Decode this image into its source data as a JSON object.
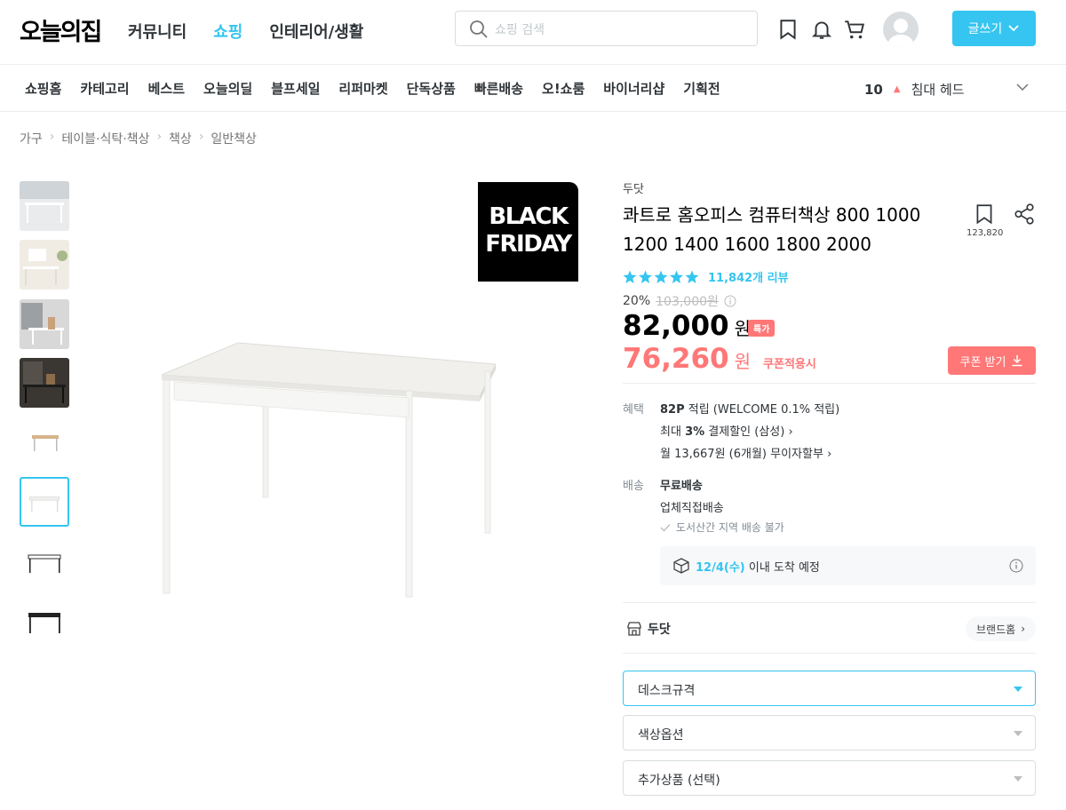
{
  "header": {
    "logo": "오늘의집",
    "nav": [
      "커뮤니티",
      "쇼핑",
      "인테리어/생활"
    ],
    "search_placeholder": "쇼핑 검색",
    "write_label": "글쓰기"
  },
  "subnav": {
    "items": [
      "쇼핑홈",
      "카테고리",
      "베스트",
      "오늘의딜",
      "블프세일",
      "리퍼마켓",
      "단독상품",
      "빠른배송",
      "오!쇼룸",
      "바이너리샵",
      "기획전"
    ],
    "rank_num": "10",
    "rank_term": "침대 헤드"
  },
  "breadcrumb": [
    "가구",
    "테이블·식탁·책상",
    "책상",
    "일반책상"
  ],
  "badge": {
    "line1": "BLACK",
    "line2": "FRIDAY"
  },
  "product": {
    "brand": "두닷",
    "title": "콰트로 홈오피스 컴퓨터책상 800 1000 1200 1400 1600 1800 2000",
    "bookmark_count": "123,820",
    "review_count": "11,842개 리뷰",
    "discount_pct": "20%",
    "original_price": "103,000원",
    "price": "82,000",
    "price_unit": "원",
    "special_tag": "특가",
    "coupon_price": "76,260",
    "coupon_unit": "원",
    "coupon_note": "쿠폰적용시",
    "coupon_button": "쿠폰 받기"
  },
  "benefit": {
    "label": "혜택",
    "points_bold": "82P",
    "points_rest": " 적립 (WELCOME 0.1% 적립)",
    "card_pre": "최대 ",
    "card_bold": "3%",
    "card_rest": " 결제할인 (삼성)",
    "install": "월 13,667원 (6개월) 무이자할부"
  },
  "delivery": {
    "label": "배송",
    "free": "무료배송",
    "method": "업체직접배송",
    "note": "도서산간 지역 배송 불가",
    "arrive_date": "12/4(수)",
    "arrive_rest": " 이내 도착 예정"
  },
  "brand_row": {
    "name": "두닷",
    "home_label": "브랜드홈"
  },
  "options": [
    "데스크규격",
    "색상옵션",
    "추가상품 (선택)"
  ]
}
